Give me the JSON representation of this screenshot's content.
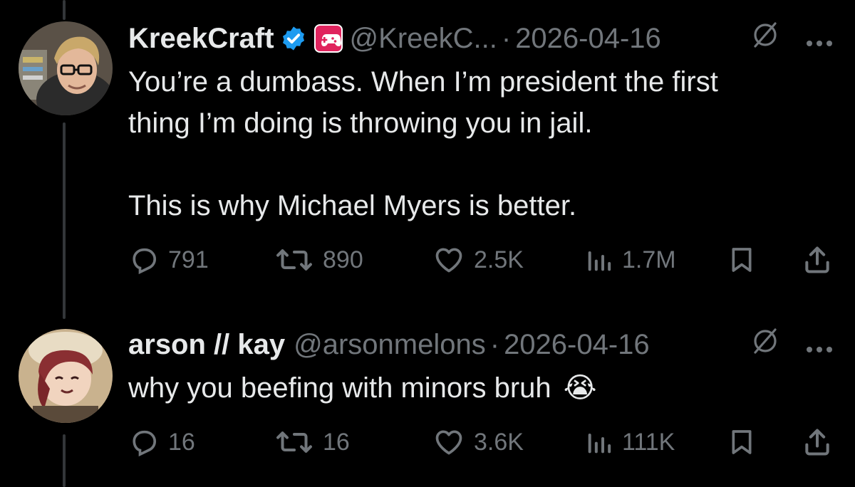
{
  "tweets": [
    {
      "display_name": "KreekCraft",
      "handle": "@KreekC...",
      "separator": "·",
      "date": "2026-04-16",
      "text_line1": "You’re a dumbass. When I’m president the first",
      "text_line2": "thing I’m doing is throwing you in jail.",
      "text_line3": "This is why Michael Myers is better.",
      "replies": "791",
      "reposts": "890",
      "likes": "2.5K",
      "views": "1.7M",
      "verified_badge": "verified-check-icon",
      "affiliate_badge": "game-controller-icon"
    },
    {
      "display_name": "arson // kay",
      "handle": "@arsonmelons",
      "separator": "·",
      "date": "2026-04-16",
      "text_line1": "why you beefing with minors bruh",
      "emoji": "😭",
      "replies": "16",
      "reposts": "16",
      "likes": "3.6K",
      "views": "111K"
    }
  ],
  "colors": {
    "background": "#000000",
    "text": "#e7e9ea",
    "muted": "#71767b",
    "verified": "#1d9bf0",
    "affiliate_badge": "#e0245e",
    "thread_line": "#333639"
  }
}
